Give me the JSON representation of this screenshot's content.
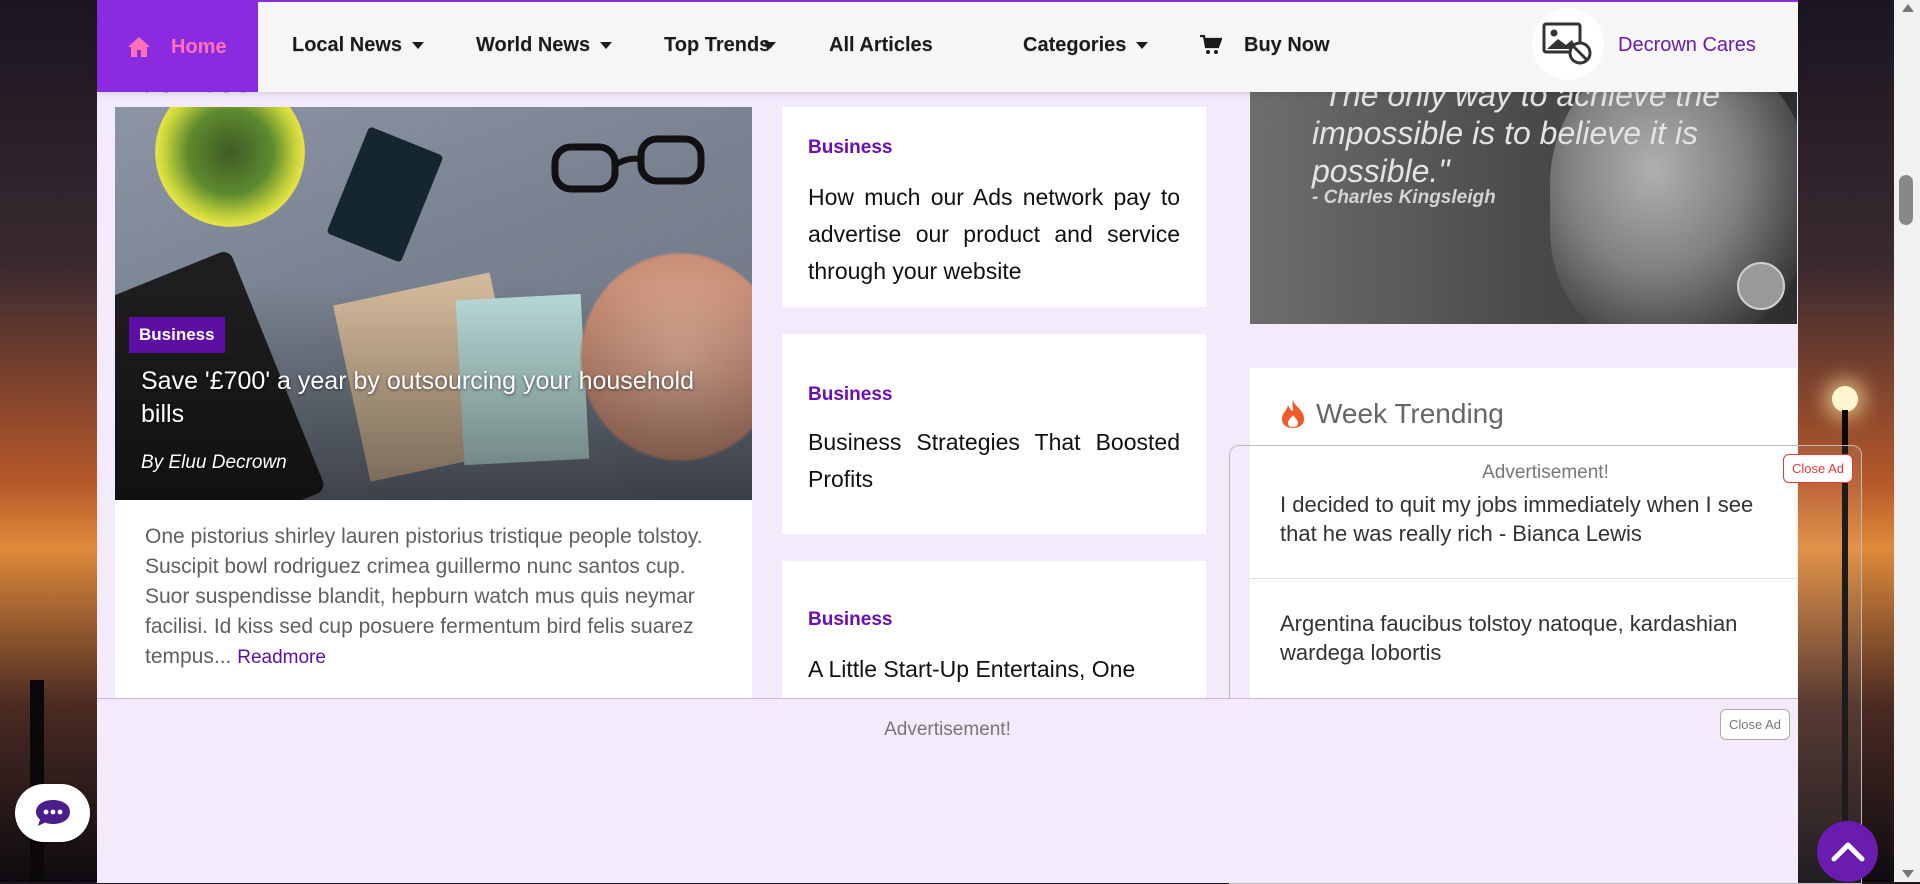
{
  "nav": {
    "home": "Home",
    "local_news": "Local News",
    "world_news": "World News",
    "top_trends": "Top Trends",
    "all_articles": "All Articles",
    "categories": "Categories",
    "buy_now": "Buy Now",
    "decrown_cares": "Decrown Cares"
  },
  "section": {
    "heading": "Business"
  },
  "feature": {
    "category": "Business",
    "title": "Save '£700' a year by outsourcing your household bills",
    "author": "By Eluu Decrown",
    "excerpt": "One pistorius shirley lauren pistorius tristique people tolstoy. Suscipit bowl rodriguez crimea guillermo nunc santos cup. Suor suspendisse blandit, hepburn watch mus quis neymar facilisi. Id kiss sed cup posuere fermentum bird felis suarez tempus...",
    "readmore": "Readmore"
  },
  "middle_cards": [
    {
      "category": "Business",
      "title": "How much our Ads network pay to advertise our product and service through your website"
    },
    {
      "category": "Business",
      "title": "Business Strategies That Boosted Profits"
    },
    {
      "category": "Business",
      "title": "A Little Start-Up Entertains, One"
    }
  ],
  "quote": {
    "text": "\"The only way to achieve the impossible is to believe it is possible.\"",
    "author": "- Charles Kingsleigh"
  },
  "trending": {
    "heading": "Week Trending",
    "items": [
      "I decided to quit my jobs immediately when I see that he was really rich - Bianca Lewis",
      "Argentina faucibus tolstoy natoque, kardashian wardega lobortis"
    ]
  },
  "ads": {
    "side_label": "Advertisement!",
    "side_close": "Close Ad",
    "bottom_label": "Advertisement!",
    "bottom_close": "Close Ad"
  },
  "colors": {
    "brand": "#8a2be2",
    "accent_dark": "#5d0fa3",
    "home_text": "#ff6fb8"
  },
  "icons": [
    "home-icon",
    "caret-down-icon",
    "cart-icon",
    "image-blocked-icon",
    "flame-icon",
    "chat-icon",
    "chevron-up-icon"
  ]
}
